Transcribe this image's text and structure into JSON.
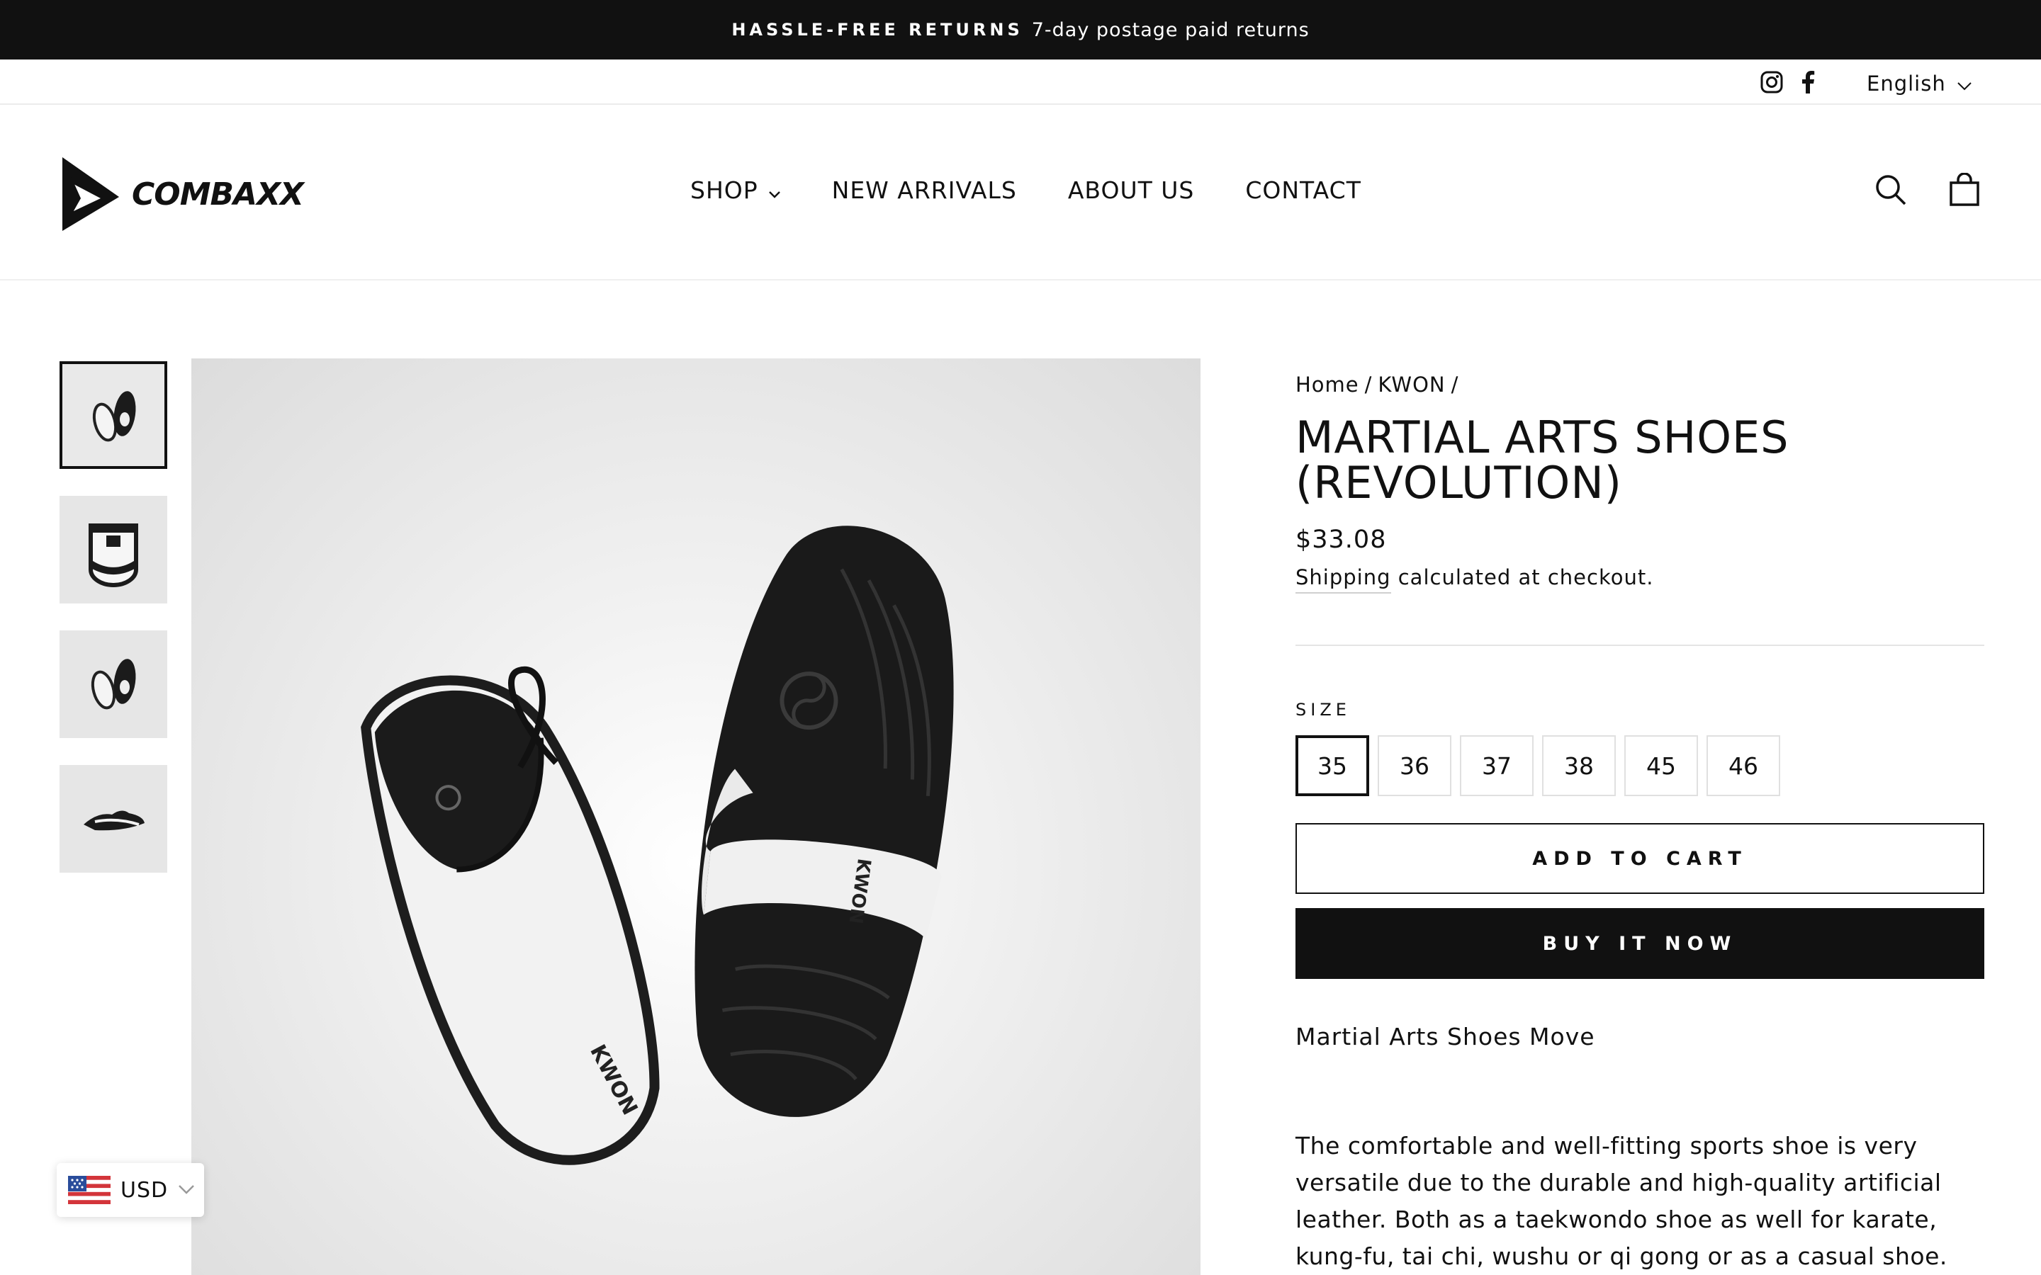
{
  "announcement": {
    "strong": "HASSLE-FREE RETURNS",
    "text": "7-day postage paid returns"
  },
  "utility": {
    "language": "English",
    "social": [
      "instagram-icon",
      "facebook-icon"
    ]
  },
  "brand": {
    "name": "COMBAXX"
  },
  "nav": {
    "items": [
      {
        "label": "SHOP",
        "has_dropdown": true
      },
      {
        "label": "NEW ARRIVALS"
      },
      {
        "label": "ABOUT US"
      },
      {
        "label": "CONTACT"
      }
    ]
  },
  "header_icons": [
    "search-icon",
    "shopping-bag-icon"
  ],
  "gallery": {
    "thumbnails": [
      "shoes-pair-top",
      "shoe-front",
      "shoes-pair-top",
      "shoe-side"
    ],
    "active_index": 0,
    "main_image": "martial-arts-shoes-pair"
  },
  "product": {
    "breadcrumb": [
      "Home",
      "/",
      "KWON",
      "/"
    ],
    "title": "MARTIAL ARTS SHOES (REVOLUTION)",
    "price": "$33.08",
    "shipping_link": "Shipping",
    "shipping_text": " calculated at checkout.",
    "size_label": "SIZE",
    "sizes": [
      "35",
      "36",
      "37",
      "38",
      "45",
      "46"
    ],
    "selected_size": "35",
    "add_to_cart": "ADD TO CART",
    "buy_now": "BUY IT NOW",
    "subtitle": "Martial Arts Shoes Move",
    "description": "The comfortable and well-fitting sports shoe is very versatile due to the durable and high-quality artificial leather. Both as a taekwondo shoe as well for karate, kung-fu, tai chi, wushu or qi gong or as a casual shoe. The"
  },
  "currency": {
    "code": "USD",
    "flag": "us-flag-icon"
  },
  "colors": {
    "dark": "#111111",
    "light_bg": "#ffffff",
    "border": "#e0e0e0"
  }
}
